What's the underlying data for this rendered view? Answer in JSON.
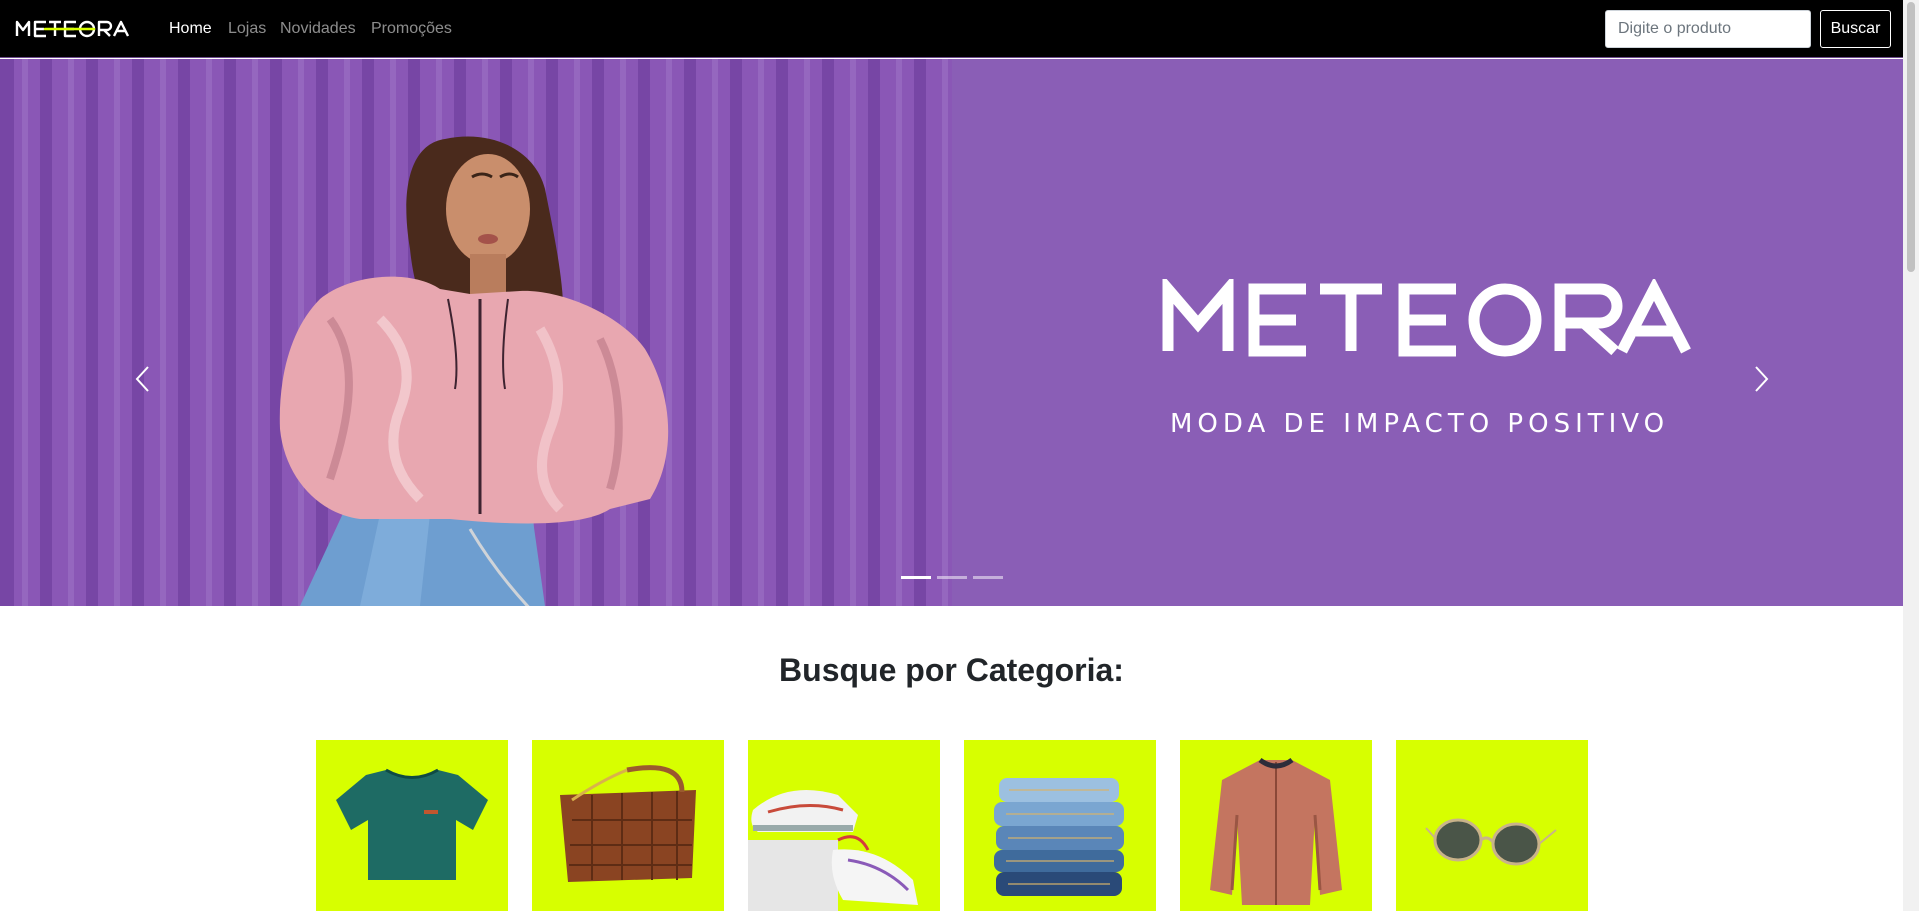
{
  "brand": {
    "name": "METEORA"
  },
  "nav": {
    "links": [
      {
        "label": "Home",
        "active": true
      },
      {
        "label": "Lojas",
        "active": false
      },
      {
        "label": "Novidades",
        "active": false
      },
      {
        "label": "Promoções",
        "active": false
      }
    ],
    "search_placeholder": "Digite o produto",
    "search_button": "Buscar"
  },
  "hero": {
    "logo_text": "METEORA",
    "tagline": "MODA DE IMPACTO POSITIVO",
    "slides_count": 3,
    "active_slide": 1,
    "background_color": "#8a5eb6",
    "accent_color": "#d7ff00"
  },
  "categories": {
    "title": "Busque por Categoria:",
    "items": [
      {
        "icon": "t-shirt-icon"
      },
      {
        "icon": "bag-icon"
      },
      {
        "icon": "sneakers-icon"
      },
      {
        "icon": "jeans-icon"
      },
      {
        "icon": "jacket-icon"
      },
      {
        "icon": "sunglasses-icon"
      }
    ]
  }
}
